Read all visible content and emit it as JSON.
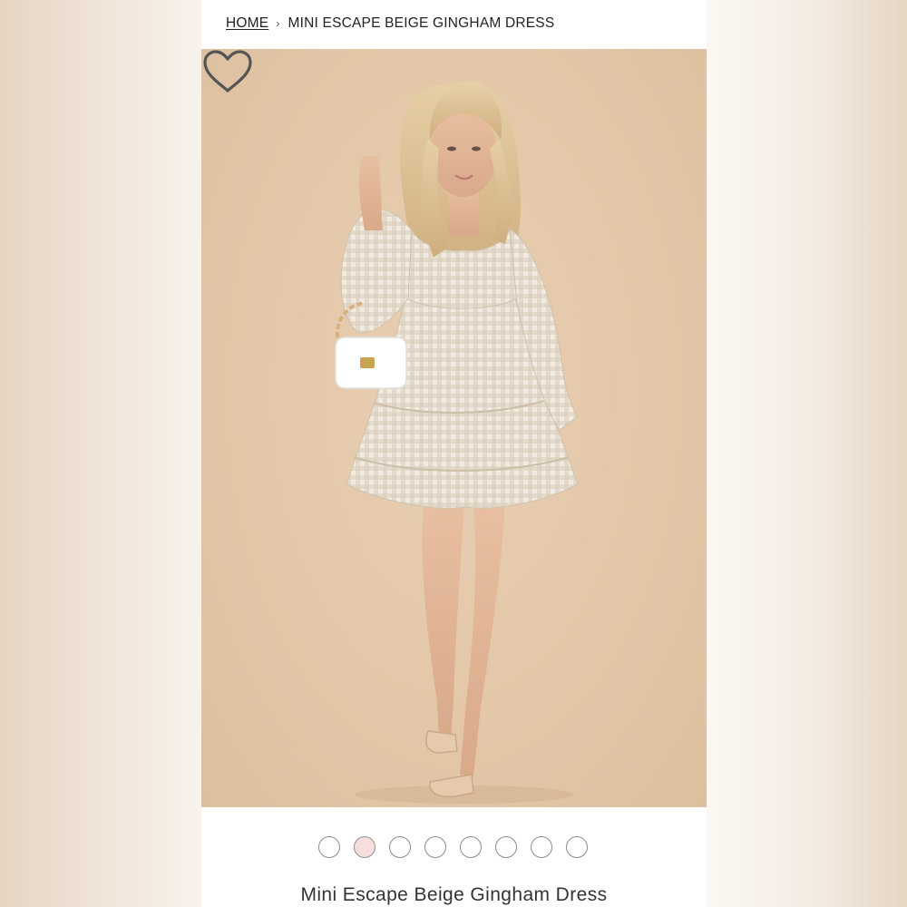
{
  "breadcrumb": {
    "home": "HOME",
    "separator": "›",
    "current": "MINI ESCAPE BEIGE GINGHAM DRESS"
  },
  "product": {
    "title": "Mini Escape Beige Gingham Dress",
    "image_icon": "product-photo",
    "wishlist_icon": "heart-icon"
  },
  "gallery": {
    "dot_count": 8,
    "active_index": 1
  },
  "colors": {
    "backdrop": "#e3c7a8",
    "active_dot": "#f6dede"
  }
}
